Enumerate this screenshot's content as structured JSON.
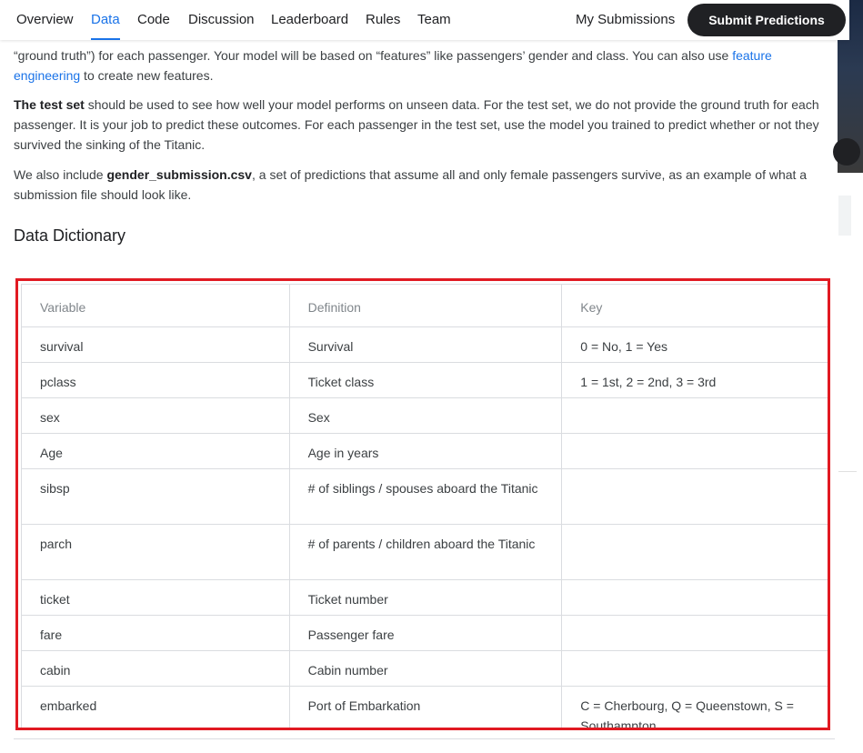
{
  "nav": {
    "tabs": [
      "Overview",
      "Data",
      "Code",
      "Discussion",
      "Leaderboard",
      "Rules",
      "Team"
    ],
    "active_tab": "Data",
    "my_submissions": "My Submissions",
    "submit_label": "Submit Predictions"
  },
  "intro": {
    "p1_start": "“ground truth”) for each passenger. Your model will be based on “features” like passengers’ gender and class. You can also use ",
    "p1_link": "feature engineering",
    "p1_end": " to create new features.",
    "p2_bold": "The test set",
    "p2_rest": " should be used to see how well your model performs on unseen data. For the test set, we do not provide the ground truth for each passenger. It is your job to predict these outcomes. For each passenger in the test set, use the model you trained to predict whether or not they survived the sinking of the Titanic.",
    "p3_start": "We also include ",
    "p3_bold": "gender_submission.csv",
    "p3_end": ", a set of predictions that assume all and only female passengers survive, as an example of what a submission file should look like."
  },
  "dictionary": {
    "heading": "Data Dictionary",
    "columns": [
      "Variable",
      "Definition",
      "Key"
    ],
    "rows": [
      [
        "survival",
        "Survival",
        "0 = No, 1 = Yes"
      ],
      [
        "pclass",
        "Ticket class",
        "1 = 1st, 2 = 2nd, 3 = 3rd"
      ],
      [
        "sex",
        "Sex",
        ""
      ],
      [
        "Age",
        "Age in years",
        ""
      ],
      [
        "sibsp",
        "# of siblings / spouses aboard the Titanic",
        ""
      ],
      [
        "parch",
        "# of parents / children aboard the Titanic",
        ""
      ],
      [
        "ticket",
        "Ticket number",
        ""
      ],
      [
        "fare",
        "Passenger fare",
        ""
      ],
      [
        "cabin",
        "Cabin number",
        ""
      ],
      [
        "embarked",
        "Port of Embarkation",
        "C = Cherbourg, Q = Queenstown, S = Southampton"
      ]
    ]
  },
  "colors": {
    "accent": "#1a73e8",
    "highlight_border": "#e11a22",
    "button_bg": "#202124"
  }
}
